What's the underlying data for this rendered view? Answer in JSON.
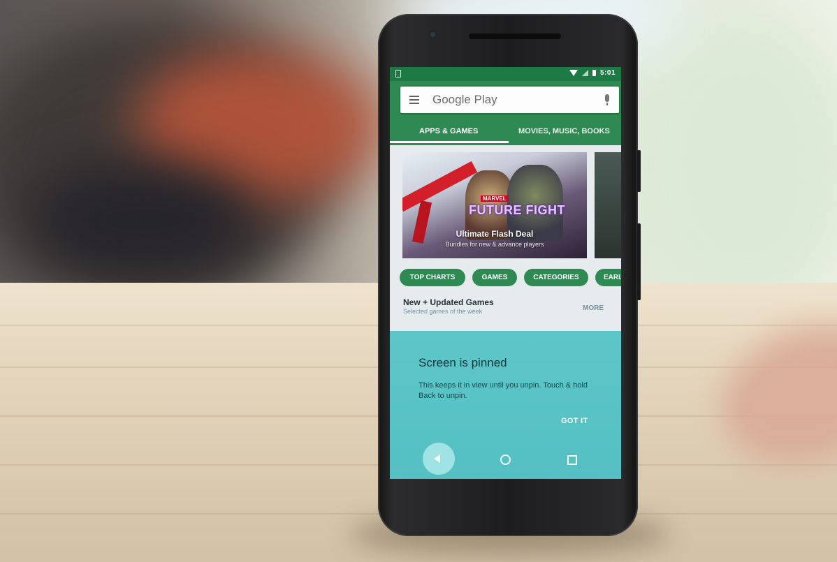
{
  "status_bar": {
    "time": "5:01"
  },
  "search": {
    "placeholder": "Google Play"
  },
  "tabs": [
    {
      "label": "APPS & GAMES",
      "selected": true
    },
    {
      "label": "MOVIES, MUSIC, BOOKS",
      "selected": false
    }
  ],
  "banner": {
    "brand": "MARVEL",
    "game_title": "FUTURE FIGHT",
    "title": "Ultimate Flash Deal",
    "subtitle": "Bundles for new & advance players"
  },
  "chips": [
    "TOP CHARTS",
    "GAMES",
    "CATEGORIES",
    "EARL"
  ],
  "section": {
    "title": "New + Updated Games",
    "subtitle": "Selected games of the week",
    "more": "MORE"
  },
  "pin_dialog": {
    "title": "Screen is pinned",
    "body": "This keeps it in view until you unpin. Touch & hold Back to unpin.",
    "action": "GOT IT"
  },
  "colors": {
    "play_green": "#2e8a52",
    "status_green": "#1e7a44",
    "pin_teal": "#5cc6c8"
  },
  "icons": [
    "menu-icon",
    "mic-icon",
    "wifi-icon",
    "signal-icon",
    "battery-icon",
    "back-icon",
    "home-icon",
    "recents-icon"
  ]
}
